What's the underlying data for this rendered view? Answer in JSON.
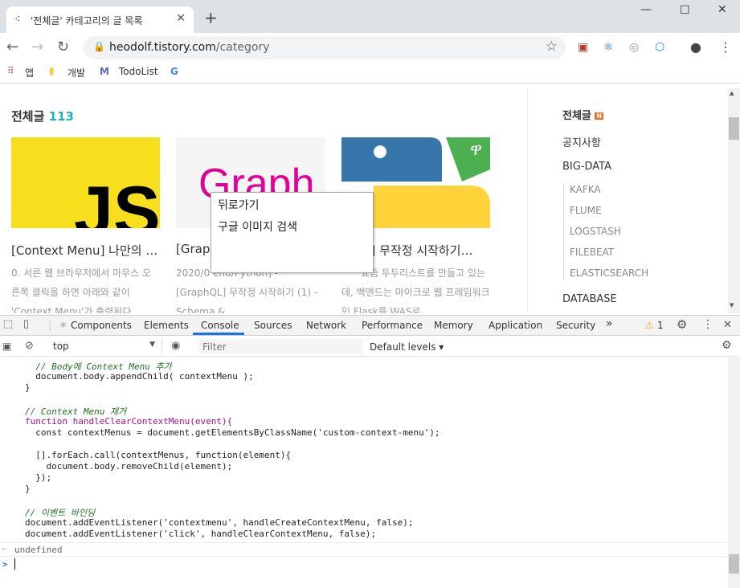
{
  "browser": {
    "tab_title": "'전체글' 카테고리의 글 목록",
    "url_host": "heodolf.tistory.com",
    "url_path": "/category",
    "new_tab": "+",
    "win_min": "—",
    "win_max": "☐",
    "win_close": "✕"
  },
  "bookmarks": {
    "apps": "앱",
    "dev": "개발",
    "todolist": "TodoList",
    "google": "G"
  },
  "page": {
    "heading": "전체글",
    "count": "113",
    "cards": [
      {
        "title": "[Context Menu] 나만의 …",
        "excerpt": "0. 서른 웹 브라우저에서 마우스 오른쪽 클릭을 하면 아래와 같이 'Context Menu'가 출력된다. …"
      },
      {
        "title": "[Grap",
        "excerpt": "2020/0 end/Python] - [GraphQL] 무작정 시작하기 (1) - Schema &…"
      },
      {
        "title": "5] 무작정 시작하기…",
        "excerpt": "요즘 투두리스트를 만들고 있는데, 백엔드는 마이크로 웹 프레임워크인 Flask를 WAS로 …"
      }
    ],
    "card1_logo": "JS",
    "card2_logo": "Graph"
  },
  "sidebar": {
    "all": "전체글",
    "new_badge": "N",
    "notice": "공지사항",
    "bigdata": "BIG-DATA",
    "subs": [
      "KAFKA",
      "FLUME",
      "LOGSTASH",
      "FILEBEAT",
      "ELASTICSEARCH"
    ],
    "database": "DATABASE"
  },
  "context_menu": {
    "back": "뒤로가기",
    "image_search": "구글 이미지 검색"
  },
  "devtools": {
    "tabs": [
      "Components",
      "Elements",
      "Console",
      "Sources",
      "Network",
      "Performance",
      "Memory",
      "Application",
      "Security"
    ],
    "more": "»",
    "warn_count": "1",
    "context": "top",
    "filter_placeholder": "Filter",
    "levels": "Default levels ▾"
  },
  "console": {
    "lines": [
      "  // Body에 Context Menu 추가",
      "  document.body.appendChild( contextMenu );",
      "}",
      "",
      "// Context Menu 제거",
      "function handleClearContextMenu(event){",
      "  const contextMenus = document.getElementsByClassName('custom-context-menu');",
      "",
      "  [].forEach.call(contextMenus, function(element){",
      "    document.body.removeChild(element);",
      "  });",
      "}",
      "",
      "// 이벤트 바인딩",
      "document.addEventListener('contextmenu', handleCreateContextMenu, false);",
      "document.addEventListener('click', handleClearContextMenu, false);"
    ],
    "result": "undefined",
    "prompt": ">"
  }
}
